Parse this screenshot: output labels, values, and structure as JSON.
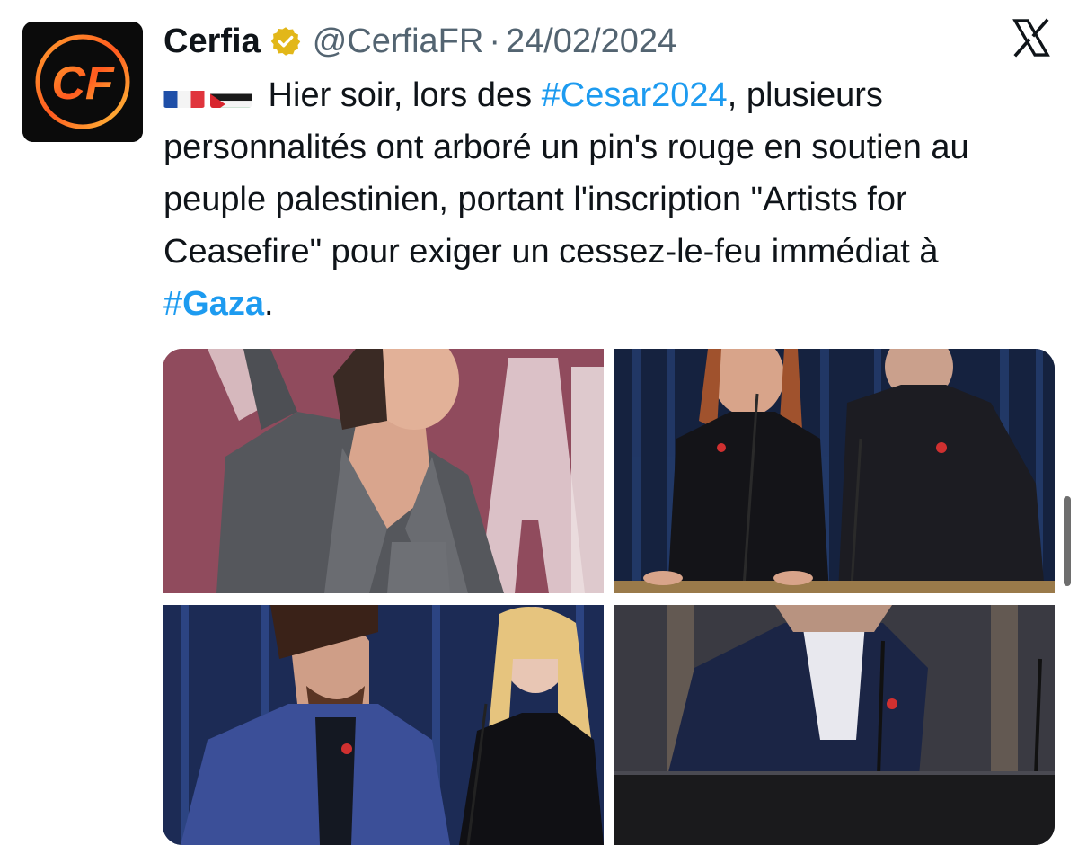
{
  "author": {
    "name": "Cerfia",
    "handle": "@CerfiaFR",
    "separator": "·",
    "date": "24/02/2024",
    "avatar_text": "CF",
    "verified_icon": "gold-verified-badge"
  },
  "platform": {
    "logo_icon": "x-logo"
  },
  "tweet": {
    "flags": [
      "france-flag",
      "palestine-flag"
    ],
    "text_part1": " Hier soir, lors des ",
    "hashtag1": "#Cesar2024",
    "text_part2": ", plusieurs personnalités ont arboré un pin's rouge en soutien au peuple palestinien, portant l'inscription \"Artists for Ceasefire\" pour exiger un cessez-le-feu immédiat à ",
    "hashtag2_prefix": "#",
    "hashtag2_word": "Gaza",
    "text_end": "."
  },
  "colors": {
    "link": "#1d9bf0",
    "text": "#0f1419",
    "secondary": "#536471",
    "verified_gold": "#e2b719"
  }
}
